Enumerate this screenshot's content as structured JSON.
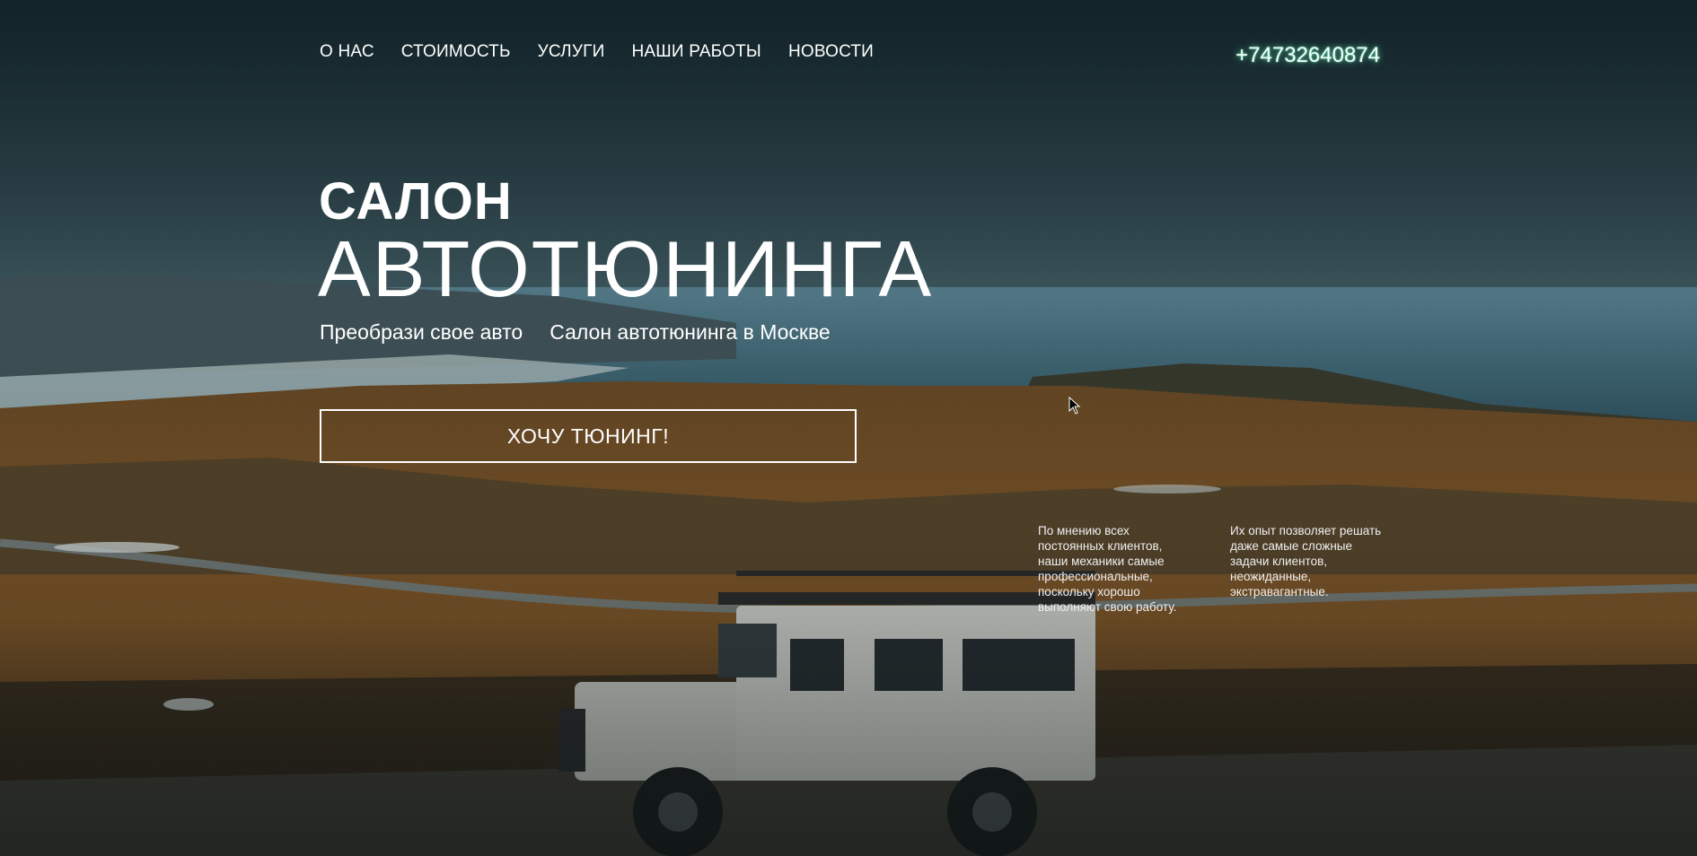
{
  "nav": {
    "items": [
      {
        "label": "О НАС"
      },
      {
        "label": "СТОИМОСТЬ"
      },
      {
        "label": "УСЛУГИ"
      },
      {
        "label": "НАШИ РАБОТЫ"
      },
      {
        "label": "НОВОСТИ"
      }
    ]
  },
  "header": {
    "phone": "+74732640874"
  },
  "hero": {
    "title_small": "САЛОН",
    "title_big": "АВТОТЮНИНГА",
    "subtitle_left": "Преобрази свое авто",
    "subtitle_right": "Салон автотюнинга в Москве",
    "cta_label": "ХОЧУ ТЮНИНГ!"
  },
  "notes": {
    "left": "По мнению всех постоянных клиентов, наши механики самые профессиональные, поскольку хорошо выполняют свою работу.",
    "right": "Их опыт позволяет решать даже самые сложные задачи клиентов, неожиданные, экстравагантные."
  },
  "colors": {
    "text": "#ffffff",
    "phone_glow": "#78ffc8",
    "sky": "#5d7a82",
    "field": "#8a5a28",
    "sea": "#4a7585"
  }
}
